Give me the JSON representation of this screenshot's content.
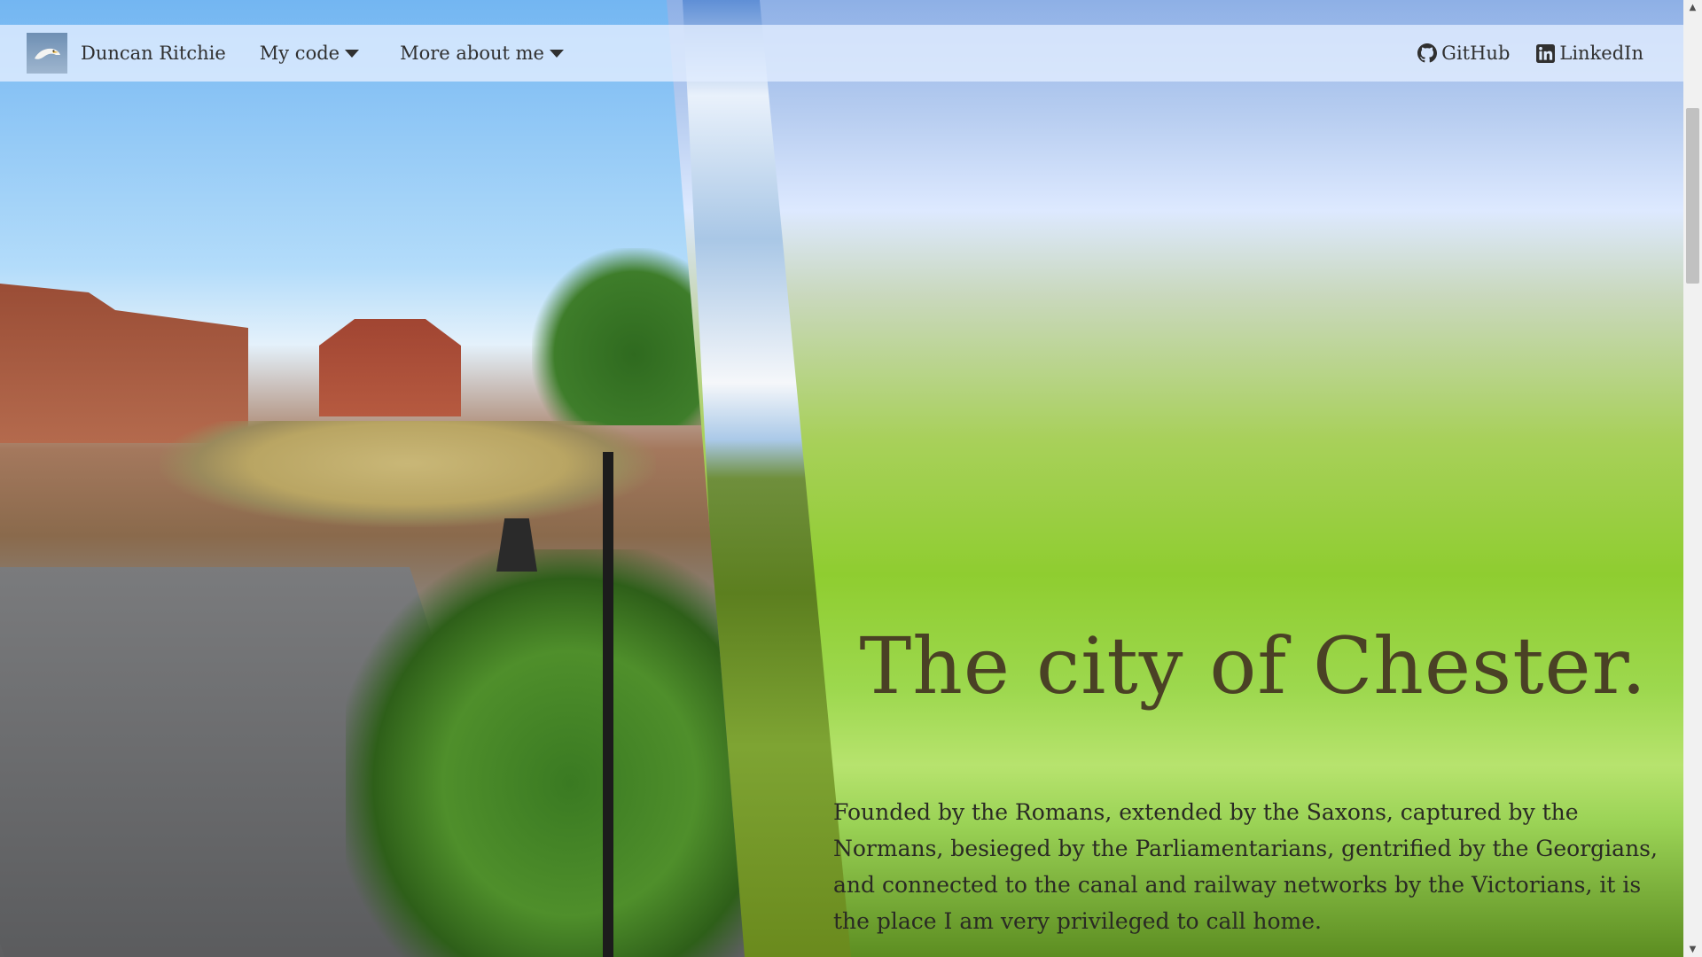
{
  "navbar": {
    "brand_name": "Duncan Ritchie",
    "brand_logo_icon": "seagull-icon",
    "menus": [
      {
        "label": "My code",
        "icon": "chevron-down-icon"
      },
      {
        "label": "More about me",
        "icon": "chevron-down-icon"
      }
    ],
    "links": [
      {
        "label": "GitHub",
        "icon": "github-icon"
      },
      {
        "label": "LinkedIn",
        "icon": "linkedin-icon"
      }
    ]
  },
  "hero": {
    "title": "The city of Chester.",
    "body": "Founded by the Romans, extended by the Saxons, captured by the Normans, besieged by the Parliamentarians, gentrified by the Georgians, and connected to the canal and railway networks by the Victorians, it is the place I am very privileged to call home.",
    "photo": "Chester Roman amphitheatre street scene",
    "text_color": "#4a4125"
  },
  "scrollbar": {
    "up_icon": "chevron-up-icon",
    "down_icon": "chevron-down-icon"
  }
}
